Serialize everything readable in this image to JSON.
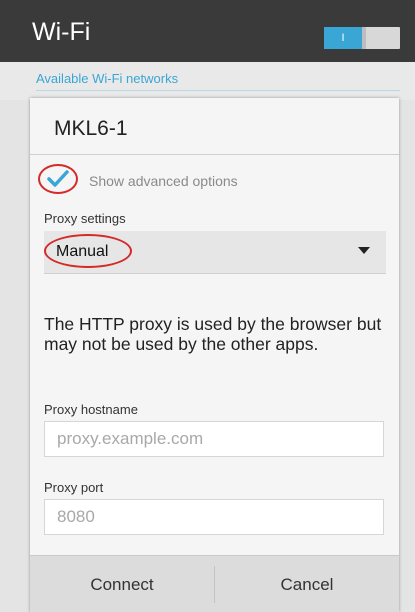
{
  "header": {
    "title": "Wi-Fi",
    "toggle_label": "I",
    "toggle_on": true
  },
  "networks": {
    "section_title": "Available Wi-Fi networks"
  },
  "dialog": {
    "title": "MKL6-1",
    "advanced": {
      "checked": true,
      "label": "Show advanced options"
    },
    "proxy_settings": {
      "label": "Proxy settings",
      "selected": "Manual"
    },
    "note": "The HTTP proxy is used by the browser but may not be used by the other apps.",
    "hostname": {
      "label": "Proxy hostname",
      "placeholder": "proxy.example.com",
      "value": ""
    },
    "port": {
      "label": "Proxy port",
      "placeholder": "8080",
      "value": ""
    },
    "buttons": {
      "connect": "Connect",
      "cancel": "Cancel"
    }
  },
  "colors": {
    "accent": "#3aa6d6",
    "annotation": "#d42a2a",
    "header_bg": "#3a3a3a"
  },
  "icons": {
    "checkmark": "checkmark-icon",
    "dropdown": "dropdown-arrow-icon"
  }
}
